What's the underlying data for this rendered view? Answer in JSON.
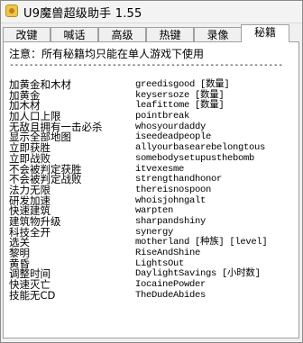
{
  "window": {
    "title": "U9魔兽超级助手 1.55"
  },
  "tabs": [
    {
      "label": "改键"
    },
    {
      "label": "喊话"
    },
    {
      "label": "高级"
    },
    {
      "label": "热键"
    },
    {
      "label": "录像"
    },
    {
      "label": "秘籍",
      "active": true
    }
  ],
  "notice": "注意：所有秘籍均只能在单人游戏下使用",
  "divider": "--------------------------------------------------------",
  "cheats": [
    {
      "name": "加黄金和木材",
      "code": "greedisgood [数量]"
    },
    {
      "name": "加黄金",
      "code": "keysersoze [数量]"
    },
    {
      "name": "加木材",
      "code": "leafittome [数量]"
    },
    {
      "name": "加人口上限",
      "code": "pointbreak"
    },
    {
      "name": "无敌且拥有一击必杀",
      "code": "whosyourdaddy"
    },
    {
      "name": "显示全部地图",
      "code": "iseedeadpeople"
    },
    {
      "name": "立即获胜",
      "code": "allyourbasearebelongtous"
    },
    {
      "name": "立即战败",
      "code": "somebodysetupusthebomb"
    },
    {
      "name": "不会被判定获胜",
      "code": "itvexesme"
    },
    {
      "name": "不会被判定战败",
      "code": "strengthandhonor"
    },
    {
      "name": "法力无限",
      "code": "thereisnospoon"
    },
    {
      "name": "研发加速",
      "code": "whoisjohngalt"
    },
    {
      "name": "快速建筑",
      "code": "warpten"
    },
    {
      "name": "建筑物升级",
      "code": "sharpandshiny"
    },
    {
      "name": "科技全开",
      "code": "synergy"
    },
    {
      "name": "选关",
      "code": "motherland [种族] [level]"
    },
    {
      "name": "黎明",
      "code": "RiseAndShine"
    },
    {
      "name": "黄昏",
      "code": "LightsOut"
    },
    {
      "name": "调整时间",
      "code": "DaylightSavings [小时数]"
    },
    {
      "name": "快速灭亡",
      "code": "IocainePowder"
    },
    {
      "name": "技能无CD",
      "code": "TheDudeAbides"
    }
  ]
}
